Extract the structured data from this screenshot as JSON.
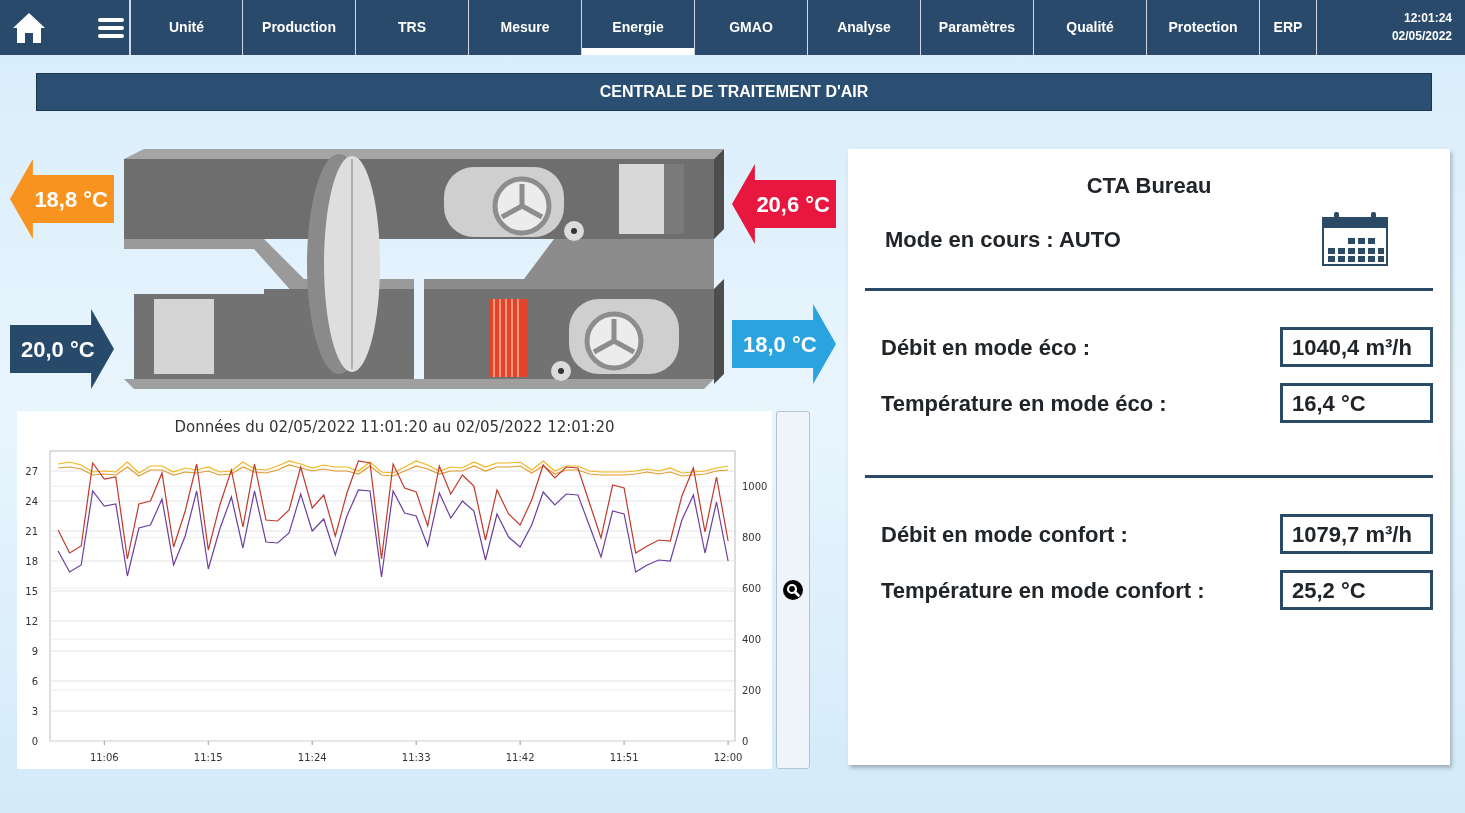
{
  "nav": {
    "tabs": [
      {
        "label": "Unité",
        "selected": false
      },
      {
        "label": "Production",
        "selected": false
      },
      {
        "label": "TRS",
        "selected": false
      },
      {
        "label": "Mesure",
        "selected": false
      },
      {
        "label": "Energie",
        "selected": true
      },
      {
        "label": "GMAO",
        "selected": false
      },
      {
        "label": "Analyse",
        "selected": false
      },
      {
        "label": "Paramètres",
        "selected": false
      },
      {
        "label": "Qualité",
        "selected": false
      },
      {
        "label": "Protection",
        "selected": false
      },
      {
        "label": "ERP",
        "selected": false
      }
    ],
    "clock": {
      "time": "12:01:24",
      "date": "02/05/2022"
    }
  },
  "title": "CENTRALE DE TRAITEMENT D'AIR",
  "temperatures": [
    {
      "value": "18,8 °C",
      "kind": "left",
      "color": "#f7931e"
    },
    {
      "value": "20,6 °C",
      "kind": "left",
      "color": "#e8173f"
    },
    {
      "value": "20,0 °C",
      "kind": "right",
      "color": "#274a6b"
    },
    {
      "value": "18,0 °C",
      "kind": "right",
      "color": "#2aa3de"
    }
  ],
  "chart_data": {
    "type": "line",
    "title": "Données du 02/05/2022 11:01:20 au 02/05/2022 12:01:20",
    "categories": [
      null,
      null,
      null,
      null,
      "11:06",
      null,
      null,
      null,
      null,
      null,
      null,
      null,
      null,
      "11:15",
      null,
      null,
      null,
      null,
      null,
      null,
      null,
      null,
      "11:24",
      null,
      null,
      null,
      null,
      null,
      null,
      null,
      null,
      "11:33",
      null,
      null,
      null,
      null,
      null,
      null,
      null,
      null,
      "11:42",
      null,
      null,
      null,
      null,
      null,
      null,
      null,
      null,
      "11:51",
      null,
      null,
      null,
      null,
      null,
      null,
      null,
      null,
      "12:00"
    ],
    "ylim": [
      0,
      29
    ],
    "y2lim": [
      0,
      1139
    ],
    "grid": true,
    "yticks": [
      0,
      3,
      6,
      9,
      12,
      15,
      18,
      21,
      24,
      27
    ],
    "y2ticks": [
      0,
      200,
      400,
      600,
      800,
      1000
    ],
    "series": [
      {
        "color": "#f2b61c",
        "values": [
          27.7,
          27.9,
          27.6,
          26.9,
          27,
          26.9,
          27.9,
          26.8,
          27.5,
          27.5,
          26.9,
          27.3,
          27.1,
          27.4,
          26.9,
          27,
          27.9,
          27.2,
          27.1,
          27.5,
          28,
          27.7,
          27.3,
          27.6,
          27.4,
          27.4,
          27,
          27.9,
          26.9,
          26.8,
          27.4,
          28,
          27.6,
          27,
          27.4,
          27.3,
          27.9,
          27.4,
          27.8,
          27.8,
          27.9,
          27.1,
          28,
          27,
          27.5,
          27.5,
          27,
          26.9,
          26.9,
          26.9,
          27,
          27.2,
          27,
          27.3,
          26.8,
          26.9,
          27,
          27.3,
          27.5
        ]
      },
      {
        "color": "#e29a2e",
        "values": [
          27.3,
          27.4,
          27.2,
          26.6,
          26.7,
          26.6,
          27.4,
          26.5,
          27.1,
          27.1,
          26.6,
          26.9,
          26.8,
          27,
          26.6,
          26.7,
          27.4,
          26.9,
          26.8,
          27.1,
          27.6,
          27.3,
          27,
          27.2,
          27,
          27,
          26.7,
          27.5,
          26.6,
          26.5,
          27,
          27.5,
          27.2,
          26.7,
          27,
          27,
          27.5,
          27,
          27.4,
          27.4,
          27.5,
          26.8,
          27.5,
          26.7,
          27.1,
          27.1,
          26.7,
          26.6,
          26.6,
          26.6,
          26.7,
          26.9,
          26.7,
          26.9,
          26.5,
          26.6,
          26.7,
          27,
          27.1
        ]
      },
      {
        "color": "#c0392b",
        "values": [
          21.1,
          18.8,
          19.5,
          27.8,
          26.2,
          26.4,
          18.2,
          23.7,
          24,
          26.8,
          19.4,
          23,
          27.7,
          19.1,
          23.6,
          27.1,
          21.4,
          27.7,
          22.1,
          22,
          23.1,
          27.4,
          23.3,
          24.6,
          20.5,
          24.8,
          28,
          27.8,
          18.2,
          27.7,
          25.3,
          24.9,
          21.5,
          27.5,
          24.7,
          26.6,
          25.5,
          20.1,
          25.1,
          22.7,
          21.6,
          24.1,
          27.6,
          26.3,
          27.4,
          27.3,
          23.8,
          20.3,
          25.6,
          25.3,
          18.8,
          19.5,
          20.1,
          20,
          24.5,
          27.3,
          20.9,
          26.4,
          20
        ]
      },
      {
        "color": "#6b3fa0",
        "values": [
          19,
          16.9,
          17.6,
          25,
          23.5,
          23.7,
          16.5,
          21.3,
          21.6,
          24.2,
          17.6,
          20.5,
          25,
          17.2,
          21.2,
          24.4,
          19.3,
          25,
          19.9,
          19.8,
          20.8,
          24.7,
          21,
          22.2,
          18.6,
          22.5,
          25.1,
          25,
          16.4,
          25,
          22.8,
          22.5,
          19.5,
          24.8,
          22.3,
          24,
          23,
          18.1,
          22.7,
          20.4,
          19.4,
          21.6,
          24.9,
          23.6,
          24.7,
          24.6,
          21.5,
          18.4,
          23,
          22.7,
          16.9,
          17.6,
          18.1,
          18,
          22.1,
          24.6,
          18.8,
          23.9,
          18
        ]
      }
    ]
  },
  "panel": {
    "title": "CTA Bureau",
    "mode": "Mode en cours : AUTO",
    "groups": [
      [
        {
          "label": "Débit en mode éco :",
          "value": "1040,4 m³/h"
        },
        {
          "label": "Température en mode éco :",
          "value": "16,4 °C"
        }
      ],
      [
        {
          "label": "Débit en mode confort :",
          "value": "1079,7 m³/h"
        },
        {
          "label": "Température en mode confort :",
          "value": "25,2 °C"
        }
      ]
    ]
  }
}
